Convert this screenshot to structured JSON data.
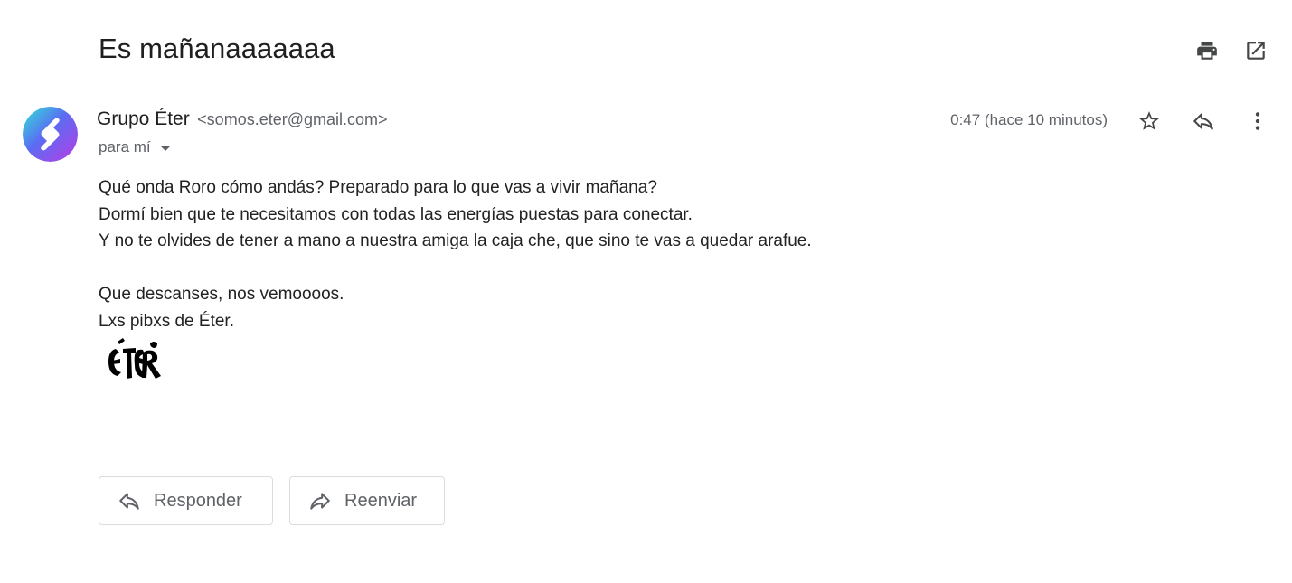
{
  "email": {
    "subject": "Es mañanaaaaaaa",
    "sender_name": "Grupo Éter",
    "sender_email": "<somos.eter@gmail.com>",
    "recipient": "para mí",
    "timestamp": "0:47 (hace 10 minutos)",
    "body_lines": [
      "Qué onda Roro cómo andás? Preparado para lo que vas a vivir mañana?",
      "Dormí bien que te necesitamos con todas las energías puestas para conectar.",
      "Y no te olvides de tener a mano a nuestra amiga la caja che, que sino te vas a quedar arafue.",
      "Que descanses, nos vemoooos.",
      "Lxs pibxs de Éter."
    ],
    "signature_logo_text": "ÉTER"
  },
  "actions": {
    "reply_label": "Responder",
    "forward_label": "Reenviar"
  },
  "icons": {
    "print": "print-icon",
    "open_new_window": "open-in-new-window-icon",
    "star": "star-icon",
    "reply": "reply-icon",
    "more": "more-vertical-icon",
    "forward": "forward-icon",
    "dropdown": "caret-down-icon"
  },
  "colors": {
    "text_primary": "#1f1f1f",
    "text_secondary": "#5f6368",
    "icon": "#444746",
    "border": "#dadce0"
  }
}
